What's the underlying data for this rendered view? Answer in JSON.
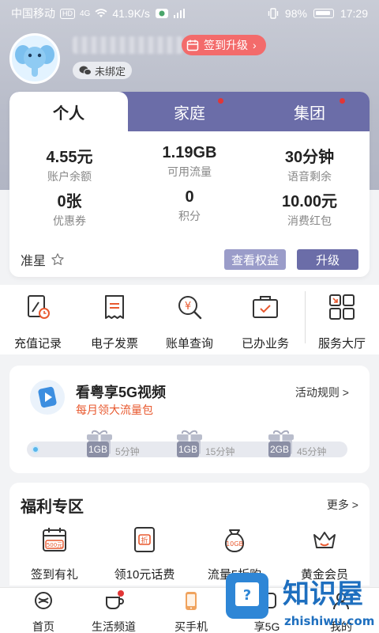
{
  "status_bar": {
    "carrier": "中国移动",
    "hd": "HD",
    "network": "4G",
    "speed": "41.9K/s",
    "battery": "98%",
    "time": "17:29"
  },
  "profile": {
    "signin_label": "签到升级",
    "bind_label": "未绑定"
  },
  "account_card": {
    "tabs": [
      {
        "label": "个人",
        "active": true,
        "dot": false
      },
      {
        "label": "家庭",
        "active": false,
        "dot": true
      },
      {
        "label": "集团",
        "active": false,
        "dot": true
      }
    ],
    "stats": [
      {
        "value": "4.55元",
        "label": "账户余额"
      },
      {
        "value": "1.19GB",
        "label": "可用流量"
      },
      {
        "value": "30分钟",
        "label": "语音剩余"
      },
      {
        "value": "0张",
        "label": "优惠券"
      },
      {
        "value": "0",
        "label": "积分"
      },
      {
        "value": "10.00元",
        "label": "消费红包"
      }
    ],
    "level": "准星",
    "view_benefits": "查看权益",
    "upgrade": "升级"
  },
  "services": [
    {
      "label": "充值记录",
      "icon": "recharge-record-icon"
    },
    {
      "label": "电子发票",
      "icon": "invoice-icon"
    },
    {
      "label": "账单查询",
      "icon": "bill-search-icon"
    },
    {
      "label": "已办业务",
      "icon": "done-business-icon"
    },
    {
      "label": "服务大厅",
      "icon": "service-hall-icon"
    }
  ],
  "video_promo": {
    "title": "看粤享5G视频",
    "subtitle": "每月领大流量包",
    "rules": "活动规则 >",
    "milestones": [
      {
        "gb": "1GB",
        "mins": "5分钟"
      },
      {
        "gb": "1GB",
        "mins": "15分钟"
      },
      {
        "gb": "2GB",
        "mins": "45分钟"
      }
    ]
  },
  "welfare": {
    "title": "福利专区",
    "more": "更多 >",
    "items": [
      {
        "label": "签到有礼",
        "icon": "calendar-icon",
        "badge": "500元"
      },
      {
        "label": "领10元话费",
        "icon": "coupon-icon",
        "badge": "折"
      },
      {
        "label": "流量5折购",
        "icon": "data-bag-icon",
        "badge": "10GB"
      },
      {
        "label": "黄金会员",
        "icon": "crown-icon",
        "badge": ""
      }
    ]
  },
  "bottom_nav": [
    {
      "label": "首页",
      "icon": "home-icon"
    },
    {
      "label": "生活频道",
      "icon": "life-icon"
    },
    {
      "label": "买手机",
      "icon": "phone-shop-icon"
    },
    {
      "label": "享5G",
      "icon": "5g-icon"
    },
    {
      "label": "我的",
      "icon": "me-icon"
    }
  ],
  "watermark": {
    "title": "知识屋",
    "url": "zhishiwu.com"
  },
  "colors": {
    "accent": "#6b6da8",
    "accent_light": "#9a9cc9",
    "signin": "#f36b6b",
    "promo_orange": "#e8592f"
  }
}
